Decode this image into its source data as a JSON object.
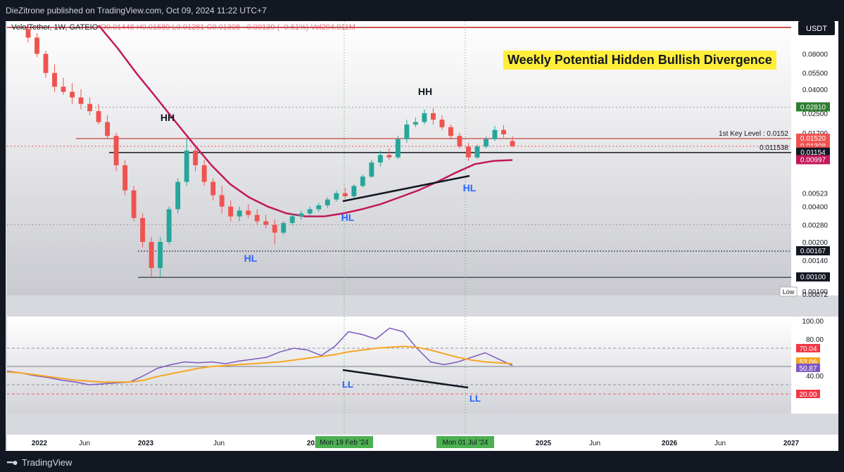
{
  "header": {
    "published": "DieZitrone published on TradingView.com, Oct 09, 2024 11:22 UTC+7"
  },
  "legend": {
    "symbol": "Velo/Tether, 1W, GATEIO",
    "o_label": "O",
    "o_value": "0.01448",
    "h_label": "H",
    "h_value": "0.01589",
    "l_label": "L",
    "l_value": "0.01281",
    "c_label": "C",
    "c_value": "0.01308",
    "change": "−0.00139 (−9.61%)",
    "vol_label": "Vol",
    "vol_value": "294.911M"
  },
  "currency_button": "USDT",
  "annotation_title": "Weekly Potential Hidden Bullish Divergence",
  "footer": {
    "brand": "TradingView"
  },
  "colors": {
    "up": "#26a69a",
    "down": "#ef5350",
    "ma": "#c2185b",
    "rsi": "#7e57c2",
    "rsi_ma": "#f5a623",
    "label_blue": "#2962ff"
  },
  "chart_data": [
    {
      "type": "candlestick",
      "scale": "log",
      "ylim": [
        0.00072,
        0.14
      ],
      "y_ticks": [
        "0.08000",
        "0.05500",
        "0.04000",
        "0.02500",
        "0.01700",
        "0.00523",
        "0.00400",
        "0.00280",
        "0.00200",
        "0.00140",
        "0.00072"
      ],
      "x_ticks": [
        "2022",
        "Jun",
        "2023",
        "Jun",
        "2024",
        "2025",
        "Jun",
        "2026",
        "Jun",
        "2027"
      ],
      "x_date_markers": [
        "Mon 19 Feb '24",
        "Mon 01 Jul '24"
      ],
      "price_labels": [
        {
          "text": "0.02810",
          "color": "#2e7d32"
        },
        {
          "text": "0.01520",
          "color": "#ef5350"
        },
        {
          "text": "0.01308",
          "color": "#ef5350"
        },
        {
          "text": "4d 20h",
          "color": "#ef5350"
        },
        {
          "text": "0.01154",
          "color": "#131722"
        },
        {
          "text": "0.00997",
          "color": "#c2185b"
        },
        {
          "text": "0.00167",
          "color": "#131722"
        },
        {
          "text": "0.00100",
          "color": "#131722"
        }
      ],
      "low_label": "Low",
      "low_value": "0.00100",
      "horizontal_levels": [
        {
          "value": 0.0152,
          "label": "1st Key Level : 0.0152"
        },
        {
          "value": 0.011538,
          "label": "0.011538"
        },
        {
          "value": 0.001,
          "label": ""
        },
        {
          "value": 0.00167,
          "label": ""
        }
      ],
      "pattern_labels": [
        "HH",
        "HH",
        "HL",
        "HL",
        "HL"
      ],
      "candles_ohlc_sampled": [
        [
          0.13,
          0.14,
          0.1,
          0.11
        ],
        [
          0.11,
          0.12,
          0.075,
          0.08
        ],
        [
          0.08,
          0.085,
          0.05,
          0.055
        ],
        [
          0.055,
          0.065,
          0.038,
          0.042
        ],
        [
          0.042,
          0.05,
          0.036,
          0.038
        ],
        [
          0.038,
          0.045,
          0.03,
          0.034
        ],
        [
          0.034,
          0.04,
          0.027,
          0.03
        ],
        [
          0.03,
          0.034,
          0.024,
          0.026
        ],
        [
          0.026,
          0.03,
          0.02,
          0.021
        ],
        [
          0.021,
          0.024,
          0.015,
          0.016
        ],
        [
          0.016,
          0.017,
          0.008,
          0.009
        ],
        [
          0.009,
          0.01,
          0.005,
          0.0055
        ],
        [
          0.0055,
          0.006,
          0.003,
          0.0032
        ],
        [
          0.0032,
          0.0035,
          0.0018,
          0.002
        ],
        [
          0.002,
          0.0022,
          0.001,
          0.0012
        ],
        [
          0.0012,
          0.0022,
          0.001,
          0.002
        ],
        [
          0.002,
          0.004,
          0.0019,
          0.0038
        ],
        [
          0.0038,
          0.007,
          0.0035,
          0.0065
        ],
        [
          0.0065,
          0.015,
          0.006,
          0.012
        ],
        [
          0.012,
          0.013,
          0.008,
          0.009
        ],
        [
          0.009,
          0.01,
          0.006,
          0.0065
        ],
        [
          0.0065,
          0.007,
          0.0045,
          0.005
        ],
        [
          0.005,
          0.006,
          0.0035,
          0.004
        ],
        [
          0.004,
          0.0045,
          0.003,
          0.0033
        ],
        [
          0.0033,
          0.004,
          0.003,
          0.0037
        ],
        [
          0.0037,
          0.0042,
          0.0032,
          0.0034
        ],
        [
          0.0034,
          0.0038,
          0.0028,
          0.003
        ],
        [
          0.003,
          0.0034,
          0.0026,
          0.0028
        ],
        [
          0.0028,
          0.0031,
          0.0019,
          0.0024
        ],
        [
          0.0024,
          0.003,
          0.0023,
          0.0029
        ],
        [
          0.0029,
          0.0035,
          0.0028,
          0.0033
        ],
        [
          0.0033,
          0.0037,
          0.0031,
          0.0035
        ],
        [
          0.0035,
          0.004,
          0.0033,
          0.0038
        ],
        [
          0.0038,
          0.0043,
          0.0036,
          0.0041
        ],
        [
          0.0041,
          0.0048,
          0.0039,
          0.0046
        ],
        [
          0.0046,
          0.0055,
          0.0044,
          0.0052
        ],
        [
          0.0052,
          0.0058,
          0.0047,
          0.0049
        ],
        [
          0.0049,
          0.0062,
          0.0047,
          0.006
        ],
        [
          0.006,
          0.0075,
          0.0058,
          0.0072
        ],
        [
          0.0072,
          0.01,
          0.007,
          0.0095
        ],
        [
          0.0095,
          0.012,
          0.0088,
          0.011
        ],
        [
          0.011,
          0.0125,
          0.01,
          0.0105
        ],
        [
          0.0105,
          0.016,
          0.0102,
          0.015
        ],
        [
          0.015,
          0.022,
          0.014,
          0.02
        ],
        [
          0.02,
          0.023,
          0.019,
          0.021
        ],
        [
          0.021,
          0.027,
          0.02,
          0.025
        ],
        [
          0.025,
          0.0275,
          0.02,
          0.022
        ],
        [
          0.022,
          0.024,
          0.018,
          0.019
        ],
        [
          0.019,
          0.02,
          0.015,
          0.016
        ],
        [
          0.016,
          0.017,
          0.0125,
          0.013
        ],
        [
          0.013,
          0.014,
          0.0098,
          0.0105
        ],
        [
          0.0105,
          0.0135,
          0.0102,
          0.013
        ],
        [
          0.013,
          0.0158,
          0.0125,
          0.015
        ],
        [
          0.015,
          0.0195,
          0.0145,
          0.018
        ],
        [
          0.018,
          0.0198,
          0.0155,
          0.0165
        ],
        [
          0.01448,
          0.01589,
          0.01281,
          0.01308
        ]
      ],
      "ma_sampled": [
        0.14,
        0.09,
        0.055,
        0.035,
        0.022,
        0.014,
        0.009,
        0.0062,
        0.0048,
        0.004,
        0.0035,
        0.0033,
        0.0033,
        0.0035,
        0.0038,
        0.0042,
        0.0048,
        0.0055,
        0.0065,
        0.0078,
        0.0092,
        0.0098,
        0.00997
      ],
      "ma_value": 0.00997
    },
    {
      "type": "line",
      "name": "RSI",
      "ylim": [
        0,
        100
      ],
      "y_ticks": [
        "100.00",
        "80.00",
        "40.00"
      ],
      "levels": [
        70,
        50,
        30
      ],
      "value_labels": [
        {
          "text": "70.04",
          "color": "#f23645"
        },
        {
          "text": "53.06",
          "color": "#f5a623"
        },
        {
          "text": "50.87",
          "color": "#7e57c2"
        },
        {
          "text": "20.00",
          "color": "#f23645"
        }
      ],
      "series": [
        {
          "values": [
            45,
            43,
            40,
            38,
            35,
            33,
            30,
            31,
            32,
            33,
            40,
            48,
            52,
            55,
            54,
            55,
            53,
            56,
            58,
            60,
            66,
            70,
            68,
            62,
            72,
            88,
            85,
            80,
            92,
            88,
            70,
            55,
            52,
            55,
            60,
            65,
            58,
            51
          ]
        },
        {
          "values": [
            44,
            43,
            41,
            39,
            37,
            35,
            34,
            33,
            33,
            33,
            35,
            39,
            42,
            45,
            48,
            50,
            51,
            52,
            53,
            54,
            55,
            57,
            59,
            61,
            63,
            66,
            68,
            70,
            71,
            72,
            71,
            68,
            64,
            60,
            57,
            55,
            54,
            53
          ]
        }
      ],
      "divergence_labels": [
        "LL",
        "LL"
      ]
    }
  ]
}
